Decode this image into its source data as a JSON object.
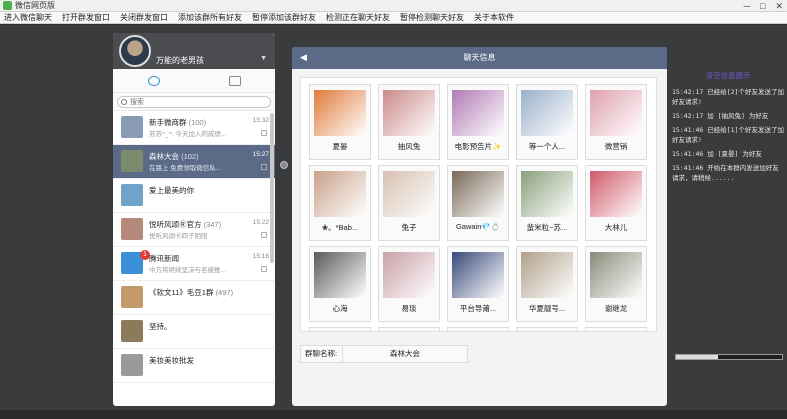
{
  "window": {
    "title": "微信网页版",
    "minimize": "─",
    "maximize": "□",
    "close": "✕"
  },
  "menu": [
    "进入微信聊天",
    "打开群发窗口",
    "关闭群发窗口",
    "添加该群所有好友",
    "暂停添加该群好友",
    "检测正在聊天好友",
    "暂停检测聊天好友",
    "关于本软件"
  ],
  "profile": {
    "name": "万能的老男孩",
    "caret": "▼"
  },
  "search": {
    "placeholder": "搜索"
  },
  "conversations": [
    {
      "name": "新手微商群",
      "count": "(100)",
      "preview": "苏苏^_^: 今天加入的成绩...",
      "time": "15:32",
      "color": "#8a9bb5",
      "selected": false,
      "badge": ""
    },
    {
      "name": "森林大会",
      "count": "(102)",
      "preview": "在路上 免费领取微信私...",
      "time": "15:27",
      "color": "#7a8a6e",
      "selected": true,
      "badge": ""
    },
    {
      "name": "爱上最美的你",
      "count": "",
      "preview": "",
      "time": "",
      "color": "#6fa3c9",
      "selected": false,
      "badge": ""
    },
    {
      "name": "悦听风颂Ⓡ官方",
      "count": "(347)",
      "preview": "悦听风颂Ⓡ四子阴阳",
      "time": "15:22",
      "color": "#b58a7a",
      "selected": false,
      "badge": ""
    },
    {
      "name": "腾讯新闻",
      "count": "",
      "preview": "中方将继续坚决与名被推...",
      "time": "15:16",
      "color": "#3a8fd6",
      "selected": false,
      "badge": "1"
    },
    {
      "name": "《软文11》毛豆1群",
      "count": "(497)",
      "preview": "",
      "time": "",
      "color": "#c29a6a",
      "selected": false,
      "badge": ""
    },
    {
      "name": "坚持。",
      "count": "",
      "preview": "",
      "time": "",
      "color": "#8c7b5a",
      "selected": false,
      "badge": ""
    },
    {
      "name": "美妆美妆批发",
      "count": "",
      "preview": "",
      "time": "",
      "color": "#9a9a9a",
      "selected": false,
      "badge": ""
    }
  ],
  "info": {
    "back": "◀",
    "title": "聊天信息",
    "members": [
      {
        "name": "夏晏",
        "color": "#e07a3a"
      },
      {
        "name": "抽风兔",
        "color": "#c98a8a"
      },
      {
        "name": "电影预告片✨",
        "color": "#b07ab5"
      },
      {
        "name": "等一个人...",
        "color": "#9ab0c9"
      },
      {
        "name": "微营销",
        "color": "#e0a0b0"
      },
      {
        "name": "❀。*Bab...",
        "color": "#c9a08a"
      },
      {
        "name": "兔子",
        "color": "#d6c0b0"
      },
      {
        "name": "Gawain💎💍",
        "color": "#7a6a5a"
      },
      {
        "name": "蜚米粒~苏...",
        "color": "#8aa07a"
      },
      {
        "name": "大林儿",
        "color": "#d05a6a"
      },
      {
        "name": "心海",
        "color": "#5a5a5a"
      },
      {
        "name": "易琰",
        "color": "#c9a0a8"
      },
      {
        "name": "平台导莆...",
        "color": "#3a4a7a"
      },
      {
        "name": "华夏靓号...",
        "color": "#b0a08a"
      },
      {
        "name": "谢继龙",
        "color": "#8a8a7a"
      },
      {
        "name": "",
        "color": "#c0b090"
      },
      {
        "name": "",
        "color": "#d0b0a0"
      },
      {
        "name": "",
        "color": "#a08070"
      },
      {
        "name": "",
        "color": "#b0a0c0"
      },
      {
        "name": "",
        "color": "#c8c0b0"
      }
    ],
    "group_name_label": "群聊名称:",
    "group_name_value": "森林大会"
  },
  "log": {
    "title": "清空信息提示",
    "entries": [
      "15:42:17 已经给[2]个好友发送了加好友请求!",
      "15:42:17 加 [抽风兔] 为好友",
      "15:41:46 已经给[1]个好友发送了加好友请求!",
      "15:41:46 加 [夏晏] 为好友",
      "15:41:46 开始在本群内发送加好友请求，请稍候......"
    ],
    "progress": 0.4
  }
}
